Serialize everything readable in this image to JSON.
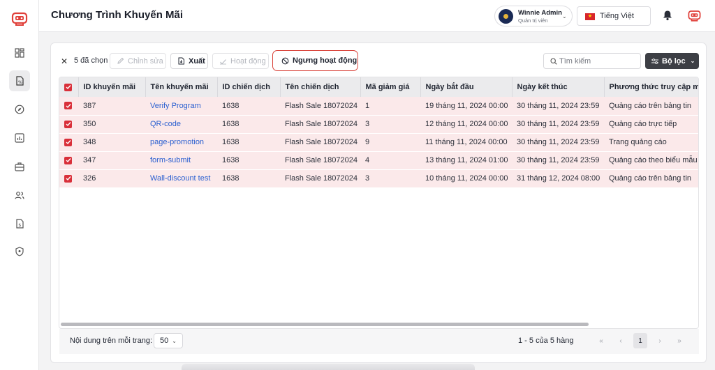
{
  "header": {
    "title": "Chương Trình Khuyến Mãi",
    "user": {
      "name": "Winnie Admin",
      "role": "Quản trị viên"
    },
    "language": "Tiếng Việt"
  },
  "toolbar": {
    "close_symbol": "✕",
    "selected": "5 đã chọn",
    "edit": "Chỉnh sửa",
    "export": "Xuất",
    "activate": "Hoạt động",
    "deactivate": "Ngưng hoạt động",
    "search_placeholder": "Tìm kiếm",
    "filter": "Bộ lọc"
  },
  "table": {
    "headers": [
      "ID khuyến mãi",
      "Tên khuyến mãi",
      "ID chiến dịch",
      "Tên chiến dịch",
      "Mã giảm giá",
      "Ngày bắt đầu",
      "Ngày kết thúc",
      "Phương thức truy cập mã"
    ],
    "rows": [
      [
        "387",
        "Verify Program",
        "1638",
        "Flash Sale 18072024",
        "1",
        "19 tháng 11, 2024 00:00",
        "30 tháng 11, 2024 23:59",
        "Quảng cáo trên bảng tin"
      ],
      [
        "350",
        "QR-code",
        "1638",
        "Flash Sale 18072024",
        "3",
        "12 tháng 11, 2024 00:00",
        "30 tháng 11, 2024 23:59",
        "Quảng cáo trực tiếp"
      ],
      [
        "348",
        "page-promotion",
        "1638",
        "Flash Sale 18072024",
        "9",
        "11 tháng 11, 2024 00:00",
        "30 tháng 11, 2024 23:59",
        "Trang quảng cáo"
      ],
      [
        "347",
        "form-submit",
        "1638",
        "Flash Sale 18072024",
        "4",
        "13 tháng 11, 2024 01:00",
        "30 tháng 11, 2024 23:59",
        "Quảng cáo theo biểu mẫu"
      ],
      [
        "326",
        "Wall-discount test",
        "1638",
        "Flash Sale 18072024",
        "3",
        "10 tháng 11, 2024 00:00",
        "31 tháng 12, 2024 08:00",
        "Quảng cáo trên bảng tin"
      ]
    ]
  },
  "footer": {
    "per_page_label": "Nội dung trên mỗi trang:",
    "per_page_value": "50",
    "range": "1 - 5 của 5 hàng",
    "pager": {
      "first": "«",
      "prev": "‹",
      "current": "1",
      "next": "›",
      "last": "»"
    }
  },
  "colors": {
    "accent": "#d9303a",
    "link": "#2a5fd0",
    "selected_row": "#fbe9ea",
    "highlight_border": "#d9433a"
  },
  "icons": {
    "sidebar": [
      "dashboard-icon",
      "promotion-document-icon",
      "compass-icon",
      "chart-icon",
      "briefcase-icon",
      "users-icon",
      "invoice-icon",
      "shield-icon"
    ]
  }
}
